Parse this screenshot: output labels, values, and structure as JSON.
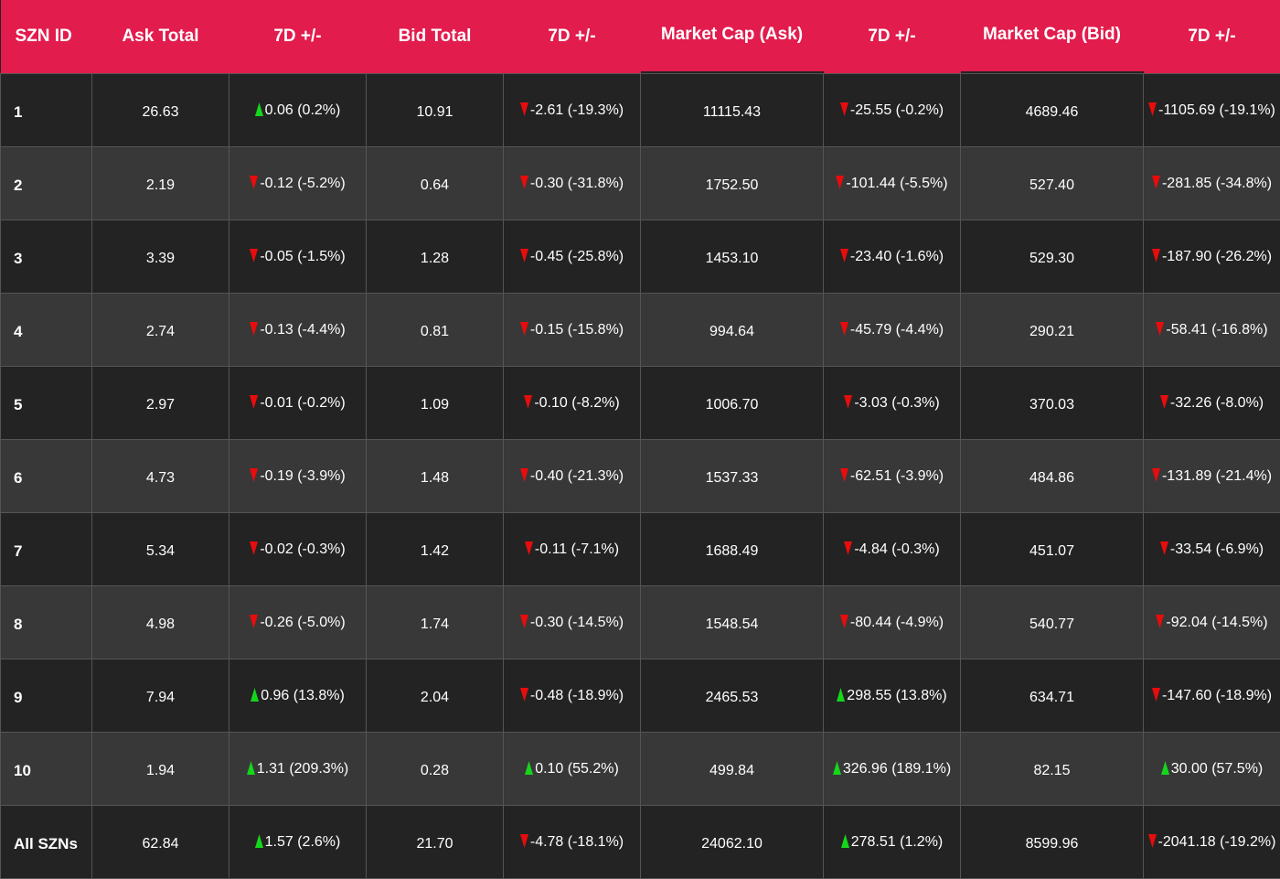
{
  "colors": {
    "header_bg": "#e21c4d",
    "row_dark": "#232323",
    "row_light": "#383838",
    "up": "#15d61b",
    "down": "#e80c0c"
  },
  "columns": [
    "SZN ID",
    "Ask Total",
    "7D +/-",
    "Bid Total",
    "7D +/-",
    "Market Cap (Ask)",
    "7D +/-",
    "Market Cap (Bid)",
    "7D +/-"
  ],
  "rows": [
    {
      "id": "1",
      "ask": "26.63",
      "ask_chg": "0.06 (0.2%)",
      "ask_dir": "up",
      "bid": "10.91",
      "bid_chg": "-2.61 (-19.3%)",
      "bid_dir": "down",
      "mc_ask": "11115.43",
      "mc_ask_chg": "-25.55 (-0.2%)",
      "mc_ask_dir": "down",
      "mc_bid": "4689.46",
      "mc_bid_chg": "-1105.69 (-19.1%)",
      "mc_bid_dir": "down"
    },
    {
      "id": "2",
      "ask": "2.19",
      "ask_chg": "-0.12 (-5.2%)",
      "ask_dir": "down",
      "bid": "0.64",
      "bid_chg": "-0.30 (-31.8%)",
      "bid_dir": "down",
      "mc_ask": "1752.50",
      "mc_ask_chg": "-101.44 (-5.5%)",
      "mc_ask_dir": "down",
      "mc_bid": "527.40",
      "mc_bid_chg": "-281.85 (-34.8%)",
      "mc_bid_dir": "down"
    },
    {
      "id": "3",
      "ask": "3.39",
      "ask_chg": "-0.05 (-1.5%)",
      "ask_dir": "down",
      "bid": "1.28",
      "bid_chg": "-0.45 (-25.8%)",
      "bid_dir": "down",
      "mc_ask": "1453.10",
      "mc_ask_chg": "-23.40 (-1.6%)",
      "mc_ask_dir": "down",
      "mc_bid": "529.30",
      "mc_bid_chg": "-187.90 (-26.2%)",
      "mc_bid_dir": "down"
    },
    {
      "id": "4",
      "ask": "2.74",
      "ask_chg": "-0.13 (-4.4%)",
      "ask_dir": "down",
      "bid": "0.81",
      "bid_chg": "-0.15 (-15.8%)",
      "bid_dir": "down",
      "mc_ask": "994.64",
      "mc_ask_chg": "-45.79 (-4.4%)",
      "mc_ask_dir": "down",
      "mc_bid": "290.21",
      "mc_bid_chg": "-58.41 (-16.8%)",
      "mc_bid_dir": "down"
    },
    {
      "id": "5",
      "ask": "2.97",
      "ask_chg": "-0.01 (-0.2%)",
      "ask_dir": "down",
      "bid": "1.09",
      "bid_chg": "-0.10 (-8.2%)",
      "bid_dir": "down",
      "mc_ask": "1006.70",
      "mc_ask_chg": "-3.03 (-0.3%)",
      "mc_ask_dir": "down",
      "mc_bid": "370.03",
      "mc_bid_chg": "-32.26 (-8.0%)",
      "mc_bid_dir": "down"
    },
    {
      "id": "6",
      "ask": "4.73",
      "ask_chg": "-0.19 (-3.9%)",
      "ask_dir": "down",
      "bid": "1.48",
      "bid_chg": "-0.40 (-21.3%)",
      "bid_dir": "down",
      "mc_ask": "1537.33",
      "mc_ask_chg": "-62.51 (-3.9%)",
      "mc_ask_dir": "down",
      "mc_bid": "484.86",
      "mc_bid_chg": "-131.89 (-21.4%)",
      "mc_bid_dir": "down"
    },
    {
      "id": "7",
      "ask": "5.34",
      "ask_chg": "-0.02 (-0.3%)",
      "ask_dir": "down",
      "bid": "1.42",
      "bid_chg": "-0.11 (-7.1%)",
      "bid_dir": "down",
      "mc_ask": "1688.49",
      "mc_ask_chg": "-4.84 (-0.3%)",
      "mc_ask_dir": "down",
      "mc_bid": "451.07",
      "mc_bid_chg": "-33.54 (-6.9%)",
      "mc_bid_dir": "down"
    },
    {
      "id": "8",
      "ask": "4.98",
      "ask_chg": "-0.26 (-5.0%)",
      "ask_dir": "down",
      "bid": "1.74",
      "bid_chg": "-0.30 (-14.5%)",
      "bid_dir": "down",
      "mc_ask": "1548.54",
      "mc_ask_chg": "-80.44 (-4.9%)",
      "mc_ask_dir": "down",
      "mc_bid": "540.77",
      "mc_bid_chg": "-92.04 (-14.5%)",
      "mc_bid_dir": "down"
    },
    {
      "id": "9",
      "ask": "7.94",
      "ask_chg": "0.96 (13.8%)",
      "ask_dir": "up",
      "bid": "2.04",
      "bid_chg": "-0.48 (-18.9%)",
      "bid_dir": "down",
      "mc_ask": "2465.53",
      "mc_ask_chg": "298.55 (13.8%)",
      "mc_ask_dir": "up",
      "mc_bid": "634.71",
      "mc_bid_chg": "-147.60 (-18.9%)",
      "mc_bid_dir": "down"
    },
    {
      "id": "10",
      "ask": "1.94",
      "ask_chg": "1.31 (209.3%)",
      "ask_dir": "up",
      "bid": "0.28",
      "bid_chg": "0.10 (55.2%)",
      "bid_dir": "up",
      "mc_ask": "499.84",
      "mc_ask_chg": "326.96 (189.1%)",
      "mc_ask_dir": "up",
      "mc_bid": "82.15",
      "mc_bid_chg": "30.00 (57.5%)",
      "mc_bid_dir": "up"
    },
    {
      "id": "All SZNs",
      "ask": "62.84",
      "ask_chg": "1.57 (2.6%)",
      "ask_dir": "up",
      "bid": "21.70",
      "bid_chg": "-4.78 (-18.1%)",
      "bid_dir": "down",
      "mc_ask": "24062.10",
      "mc_ask_chg": "278.51 (1.2%)",
      "mc_ask_dir": "up",
      "mc_bid": "8599.96",
      "mc_bid_chg": "-2041.18 (-19.2%)",
      "mc_bid_dir": "down"
    }
  ]
}
